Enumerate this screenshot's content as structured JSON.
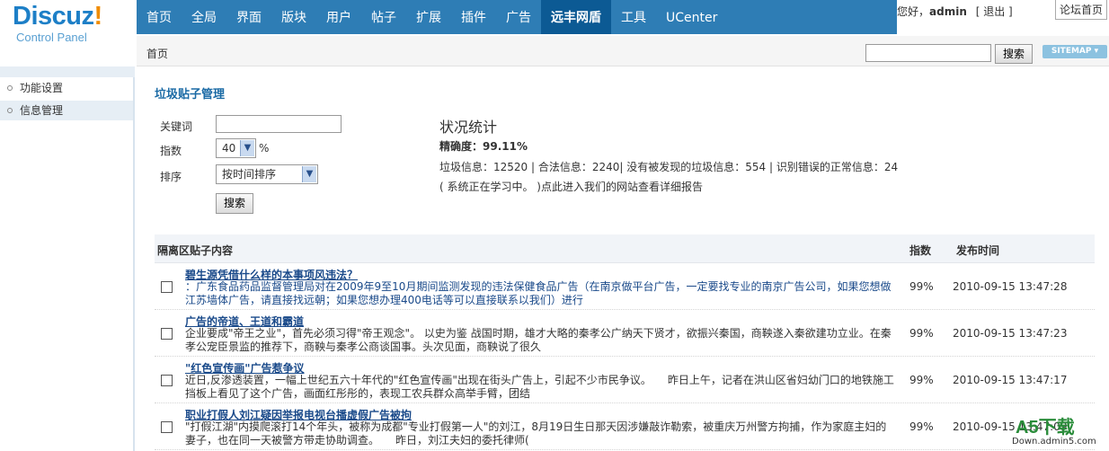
{
  "logo": {
    "brand": "Discuz",
    "bang": "!",
    "subtitle": "Control Panel"
  },
  "nav": {
    "items": [
      "首页",
      "全局",
      "界面",
      "版块",
      "用户",
      "帖子",
      "扩展",
      "插件",
      "广告",
      "远丰网盾",
      "工具",
      "UCenter"
    ],
    "active_index": 9
  },
  "user": {
    "greeting_prefix": "您好，",
    "name": "admin",
    "logout": "[ 退出 ]",
    "forum_home": "论坛首页"
  },
  "breadcrumb": {
    "home": "首页"
  },
  "top_search": {
    "button": "搜索",
    "sitemap": "SITEMAP ▾"
  },
  "sidebar": {
    "items": [
      "功能设置",
      "信息管理"
    ],
    "active_index": 1
  },
  "main": {
    "title": "垃圾贴子管理",
    "form": {
      "keyword_label": "关键词",
      "index_label": "指数",
      "index_value": "40",
      "percent": "%",
      "sort_label": "排序",
      "sort_value": "按时间排序",
      "search_button": "搜索"
    },
    "stats": {
      "title": "状况统计",
      "accuracy": "精确度：99.11%",
      "line": "垃圾信息：12520 | 合法信息：2240| 没有被发现的垃圾信息：554 | 识别错误的正常信息：24",
      "note": "( 系统正在学习中。 )点此进入我们的网站查看详细报告"
    },
    "table": {
      "headers": {
        "content": "隔离区贴子内容",
        "index": "指数",
        "time": "发布时间"
      },
      "rows": [
        {
          "title": "碧生源凭借什么样的本事项风违法？",
          "body": "：广东食品药品监督管理局对在2009年9至10月期间监测发现的违法保健食品广告（在南京做平台广告，一定要找专业的南京广告公司，如果您想做江苏墙体广告，请直接找远朝；如果您想办理400电话等可以直接联系以我们）进行",
          "index": "99%",
          "time": "2010-09-15 13:47:28"
        },
        {
          "title": "广告的帝道、王道和霸道",
          "body": "企业要成\"帝王之业\"，首先必须习得\"帝王观念\"。 以史为鉴 战国时期，雄才大略的秦孝公广纳天下贤才，欲振兴秦国，商鞅遂入秦欲建功立业。在秦孝公宠臣景监的推荐下，商鞅与秦孝公商谈国事。头次见面，商鞅说了很久",
          "index": "99%",
          "time": "2010-09-15 13:47:23"
        },
        {
          "title": "\"红色宣传画\"广告惹争议",
          "body": "近日,反渗透装置，一幅上世纪五六十年代的\"红色宣传画\"出现在街头广告上，引起不少市民争议。　　昨日上午，记者在洪山区省妇幼门口的地铁施工挡板上看见了这个广告，画面红彤彤的，表现工农兵群众高举手臂，团结",
          "index": "99%",
          "time": "2010-09-15 13:47:17"
        },
        {
          "title": "职业打假人刘江疑因举报电视台播虚假广告被拘",
          "body": "\"打假江湖\"内摸爬滚打14个年头，被称为成都\"专业打假第一人\"的刘江，8月19日生日那天因涉嫌敲诈勒索，被重庆万州警方拘捕，作为家庭主妇的妻子，也在同一天被警方带走协助调查。　　昨日，刘江夫妇的委托律师(",
          "index": "99%",
          "time": "2010-09-15 13:47:09"
        }
      ]
    }
  },
  "watermark": {
    "main": "A5下载",
    "sub": "Down.admin5.com"
  }
}
